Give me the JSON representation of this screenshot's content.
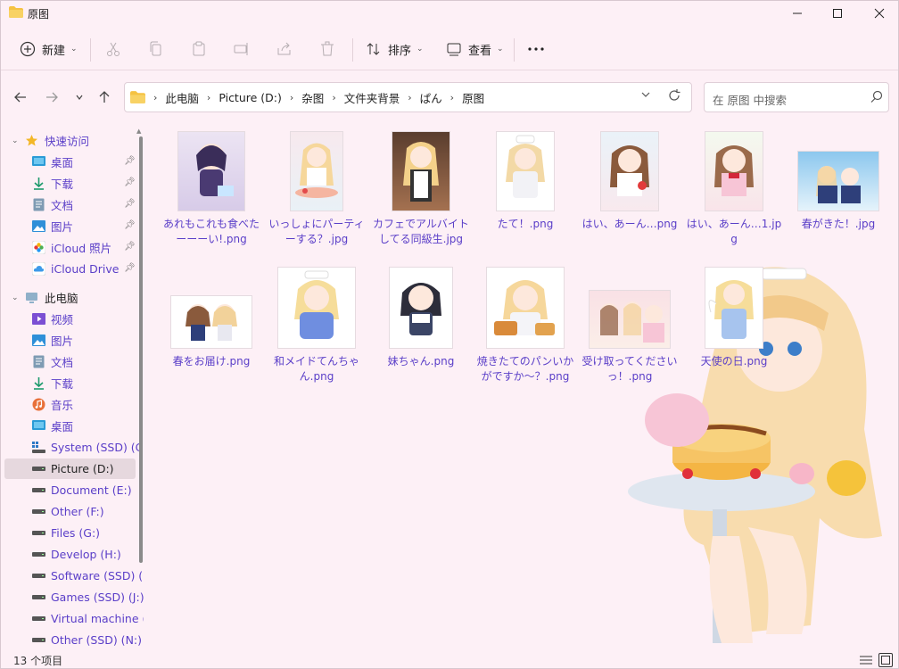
{
  "window": {
    "title": "原图"
  },
  "toolbar": {
    "new_label": "新建",
    "sort_label": "排序",
    "view_label": "查看"
  },
  "address": {
    "crumbs": [
      "此电脑",
      "Picture (D:)",
      "杂图",
      "文件夹背景",
      "ぱん",
      "原图"
    ],
    "search_placeholder": "在 原图 中搜索"
  },
  "sidebar": {
    "items": [
      {
        "label": "快速访问",
        "icon": "star-icon"
      },
      {
        "label": "桌面",
        "icon": "desktop-icon",
        "pinned": true
      },
      {
        "label": "下载",
        "icon": "download-icon",
        "pinned": true
      },
      {
        "label": "文档",
        "icon": "document-icon",
        "pinned": true
      },
      {
        "label": "图片",
        "icon": "pictures-icon",
        "pinned": true
      },
      {
        "label": "iCloud 照片",
        "icon": "icloud-photos-icon",
        "pinned": true
      },
      {
        "label": "iCloud Drive",
        "icon": "icloud-drive-icon",
        "pinned": true
      },
      {
        "label": "此电脑",
        "icon": "computer-icon"
      },
      {
        "label": "视频",
        "icon": "video-icon"
      },
      {
        "label": "图片",
        "icon": "pictures-icon"
      },
      {
        "label": "文档",
        "icon": "document-icon"
      },
      {
        "label": "下载",
        "icon": "download-icon"
      },
      {
        "label": "音乐",
        "icon": "music-icon"
      },
      {
        "label": "桌面",
        "icon": "desktop-icon"
      },
      {
        "label": "System (SSD) (C:)",
        "icon": "system-drive-icon"
      },
      {
        "label": "Picture (D:)",
        "icon": "drive-icon",
        "selected": true
      },
      {
        "label": "Document (E:)",
        "icon": "drive-icon"
      },
      {
        "label": "Other (F:)",
        "icon": "drive-icon"
      },
      {
        "label": "Files (G:)",
        "icon": "drive-icon"
      },
      {
        "label": "Develop (H:)",
        "icon": "drive-icon"
      },
      {
        "label": "Software (SSD) (I:)",
        "icon": "drive-icon"
      },
      {
        "label": "Games (SSD) (J:)",
        "icon": "drive-icon"
      },
      {
        "label": "Virtual machine (K:)",
        "icon": "drive-icon"
      },
      {
        "label": "Other (SSD) (N:)",
        "icon": "drive-icon"
      }
    ]
  },
  "files": [
    {
      "name": "あれもこれも食べたーーーい!.png"
    },
    {
      "name": "いっしょにパーティーする？.jpg"
    },
    {
      "name": "カフェでアルバイトしてる同級生.jpg"
    },
    {
      "name": "たて！.png"
    },
    {
      "name": "はい、あーん…png"
    },
    {
      "name": "はい、あーん…1.jpg"
    },
    {
      "name": "春がきた！.jpg"
    },
    {
      "name": "春をお届け.png"
    },
    {
      "name": "和メイドてんちゃん.png"
    },
    {
      "name": "妹ちゃん.png"
    },
    {
      "name": "焼きたてのパンいかがですか～？.png"
    },
    {
      "name": "受け取ってくださいっ！.png"
    },
    {
      "name": "天使の日.png"
    }
  ],
  "status": {
    "item_count": "13 个项目"
  },
  "colors": {
    "accent": "#5a3ec8",
    "background": "#fdf0f6",
    "folder": "#f5c242"
  }
}
